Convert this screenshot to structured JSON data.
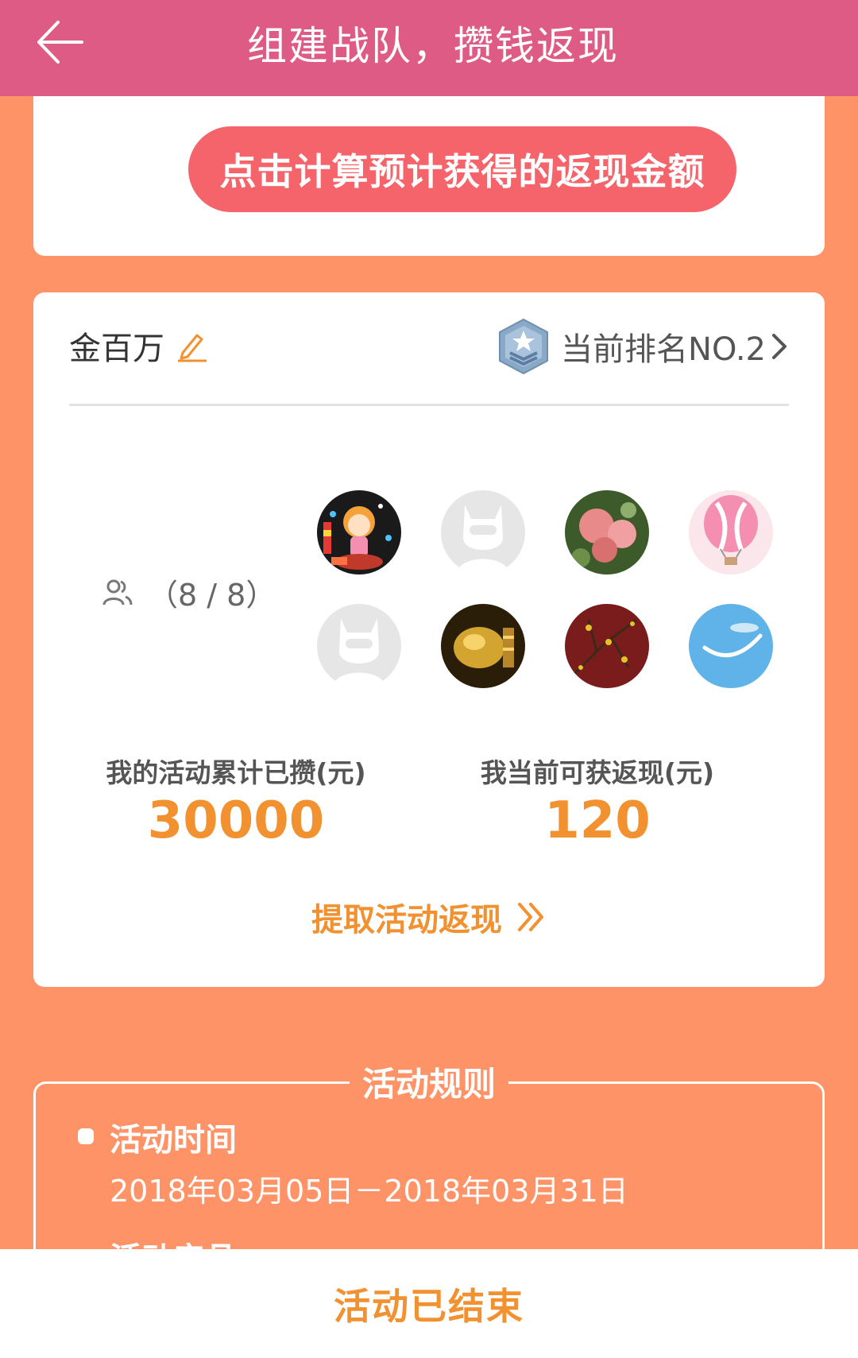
{
  "header": {
    "title": "组建战队，攒钱返现",
    "back_icon": "arrow-left-icon"
  },
  "calc": {
    "button_label": "点击计算预计获得的返现金额",
    "color": "#f4646a"
  },
  "team": {
    "name": "金百万",
    "edit_icon": "pencil-icon",
    "rank_label": "当前排名NO.2",
    "rank_icon": "rank-badge-icon",
    "members_count": "（8 / 8）",
    "members_icon": "people-icon",
    "members": [
      {
        "name": "avatar-cartoon-girl"
      },
      {
        "name": "avatar-default"
      },
      {
        "name": "avatar-roses"
      },
      {
        "name": "avatar-balloon"
      },
      {
        "name": "avatar-default"
      },
      {
        "name": "avatar-gold-pig"
      },
      {
        "name": "avatar-plum-blossom"
      },
      {
        "name": "avatar-sky"
      }
    ]
  },
  "stats": {
    "saved_label": "我的活动累计已攒(元)",
    "saved_value": "30000",
    "cashback_label": "我当前可获返现(元)",
    "cashback_value": "120",
    "accent": "#f29130"
  },
  "withdraw": {
    "label": "提取活动返现"
  },
  "rules": {
    "title": "活动规则",
    "time_heading": "活动时间",
    "time_value": "2018年03月05日－2018年03月31日",
    "product_heading": "活动产品"
  },
  "bottom": {
    "status": "活动已结束"
  },
  "colors": {
    "header_bg": "#de5b85",
    "page_bg": "#fd9366"
  }
}
